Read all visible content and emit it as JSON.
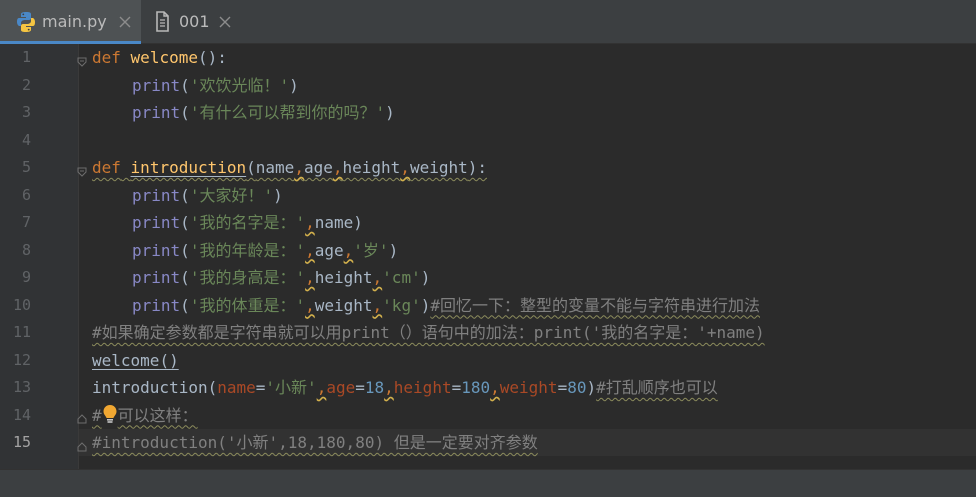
{
  "tabs": [
    {
      "label": "main.py",
      "icon": "python-file-icon",
      "active": true
    },
    {
      "label": "001",
      "icon": "text-file-icon",
      "active": false
    }
  ],
  "current_line": 15,
  "code_lines": [
    {
      "number": "1"
    },
    {
      "number": "2"
    },
    {
      "number": "3"
    },
    {
      "number": "4"
    },
    {
      "number": "5"
    },
    {
      "number": "6"
    },
    {
      "number": "7"
    },
    {
      "number": "8"
    },
    {
      "number": "9"
    },
    {
      "number": "10"
    },
    {
      "number": "11"
    },
    {
      "number": "12"
    },
    {
      "number": "13"
    },
    {
      "number": "14"
    },
    {
      "number": "15"
    }
  ],
  "code": {
    "l1": {
      "kw": "def",
      "name": "welcome",
      "rest": "():"
    },
    "l2": {
      "fn": "print",
      "open": "(",
      "s": "'欢饮光临！'",
      "close": ")"
    },
    "l3": {
      "fn": "print",
      "open": "(",
      "s": "'有什么可以帮到你的吗？'",
      "close": ")"
    },
    "l5": {
      "kw": "def",
      "name": "introduction",
      "open": "(",
      "p1": "name",
      "p2": "age",
      "p3": "height",
      "p4": "weight",
      "close": "):"
    },
    "l6": {
      "fn": "print",
      "open": "(",
      "s": "'大家好！'",
      "close": ")"
    },
    "l7": {
      "fn": "print",
      "open": "(",
      "s": "'我的名字是：'",
      "var": "name",
      "close": ")"
    },
    "l8": {
      "fn": "print",
      "open": "(",
      "s": "'我的年龄是：'",
      "var": "age",
      "s2": "'岁'",
      "close": ")"
    },
    "l9": {
      "fn": "print",
      "open": "(",
      "s": "'我的身高是：'",
      "var": "height",
      "s2": "'cm'",
      "close": ")"
    },
    "l10": {
      "fn": "print",
      "open": "(",
      "s": "'我的体重是：'",
      "var": "weight",
      "s2": "'kg'",
      "close": ")",
      "cmt": "#回忆一下：整型的变量不能与字符串进行加法"
    },
    "l11": {
      "cmt": "#如果确定参数都是字符串就可以用print（）语句中的加法：print('我的名字是：'+name)"
    },
    "l12": {
      "call": "welcome",
      "rest": "()"
    },
    "l13": {
      "call": "introduction",
      "open": "(",
      "k1": "name",
      "v1": "'小新'",
      "k2": "age",
      "v2": "18",
      "k3": "height",
      "v3": "180",
      "k4": "weight",
      "v4": "80",
      "close": ")",
      "cmt": "#打乱顺序也可以"
    },
    "l14": {
      "cmt_a": "#",
      "cmt_b": "可以这样："
    },
    "l15": {
      "cmt": "#introduction('小新',18,180,80) 但是一定要对齐参数"
    }
  },
  "colors": {
    "background": "#2b2b2b",
    "keyword": "#cc7832",
    "function_name": "#ffc66d",
    "builtin": "#8888c6",
    "string": "#6a8759",
    "number": "#6897bb",
    "named_param": "#aa4926",
    "comment": "#808080",
    "text": "#a9b7c6"
  }
}
